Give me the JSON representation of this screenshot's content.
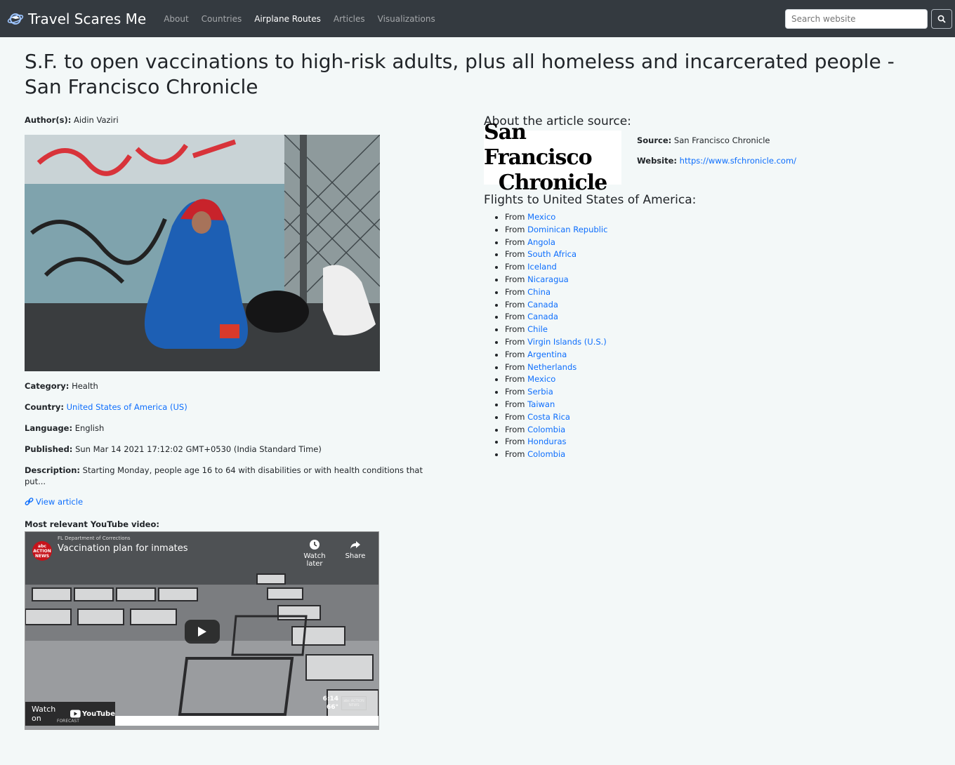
{
  "nav": {
    "brand": "Travel Scares Me",
    "links": [
      "About",
      "Countries",
      "Airplane Routes",
      "Articles",
      "Visualizations"
    ],
    "search_placeholder": "Search website"
  },
  "article": {
    "title": "S.F. to open vaccinations to high-risk adults, plus all homeless and incarcerated people - San Francisco Chronicle",
    "authors_label": "Author(s):",
    "authors": "Aidin Vaziri",
    "category_label": "Category:",
    "category": "Health",
    "country_label": "Country:",
    "country": "United States of America (US)",
    "language_label": "Language:",
    "language": "English",
    "published_label": "Published:",
    "published": "Sun Mar 14 2021 17:12:02 GMT+0530 (India Standard Time)",
    "description_label": "Description:",
    "description": "Starting Monday, people age 16 to 64 with disabilities or with health conditions that put...",
    "view_link": "View article",
    "youtube_label": "Most relevant YouTube video:"
  },
  "video": {
    "title": "Vaccination plan for inmates",
    "channel_badge": "abc ACTION NEWS",
    "overlay_small": "FL Department of Corrections",
    "watch_later": "Watch later",
    "share": "Share",
    "watch_on": "Watch on",
    "youtube": "YouTube",
    "time": "6:14",
    "temp": "66°",
    "corner_badge": "abc ACTION NEWS",
    "forecast": "FORECAST"
  },
  "source": {
    "heading": "About the article source:",
    "logo_line1": "San Francisco",
    "logo_line2": "Chronicle",
    "source_label": "Source:",
    "source": "San Francisco Chronicle",
    "website_label": "Website:",
    "website": "https://www.sfchronicle.com/"
  },
  "flights": {
    "heading": "Flights to United States of America:",
    "prefix": "From",
    "origins": [
      "Mexico",
      "Dominican Republic",
      "Angola",
      "South Africa",
      "Iceland",
      "Nicaragua",
      "China",
      "Canada",
      "Canada",
      "Chile",
      "Virgin Islands (U.S.)",
      "Argentina",
      "Netherlands",
      "Mexico",
      "Serbia",
      "Taiwan",
      "Costa Rica",
      "Colombia",
      "Honduras",
      "Colombia"
    ]
  },
  "colors": {
    "navbar": "#343a40",
    "link": "#0d6efd",
    "background": "#f3f8f8"
  }
}
